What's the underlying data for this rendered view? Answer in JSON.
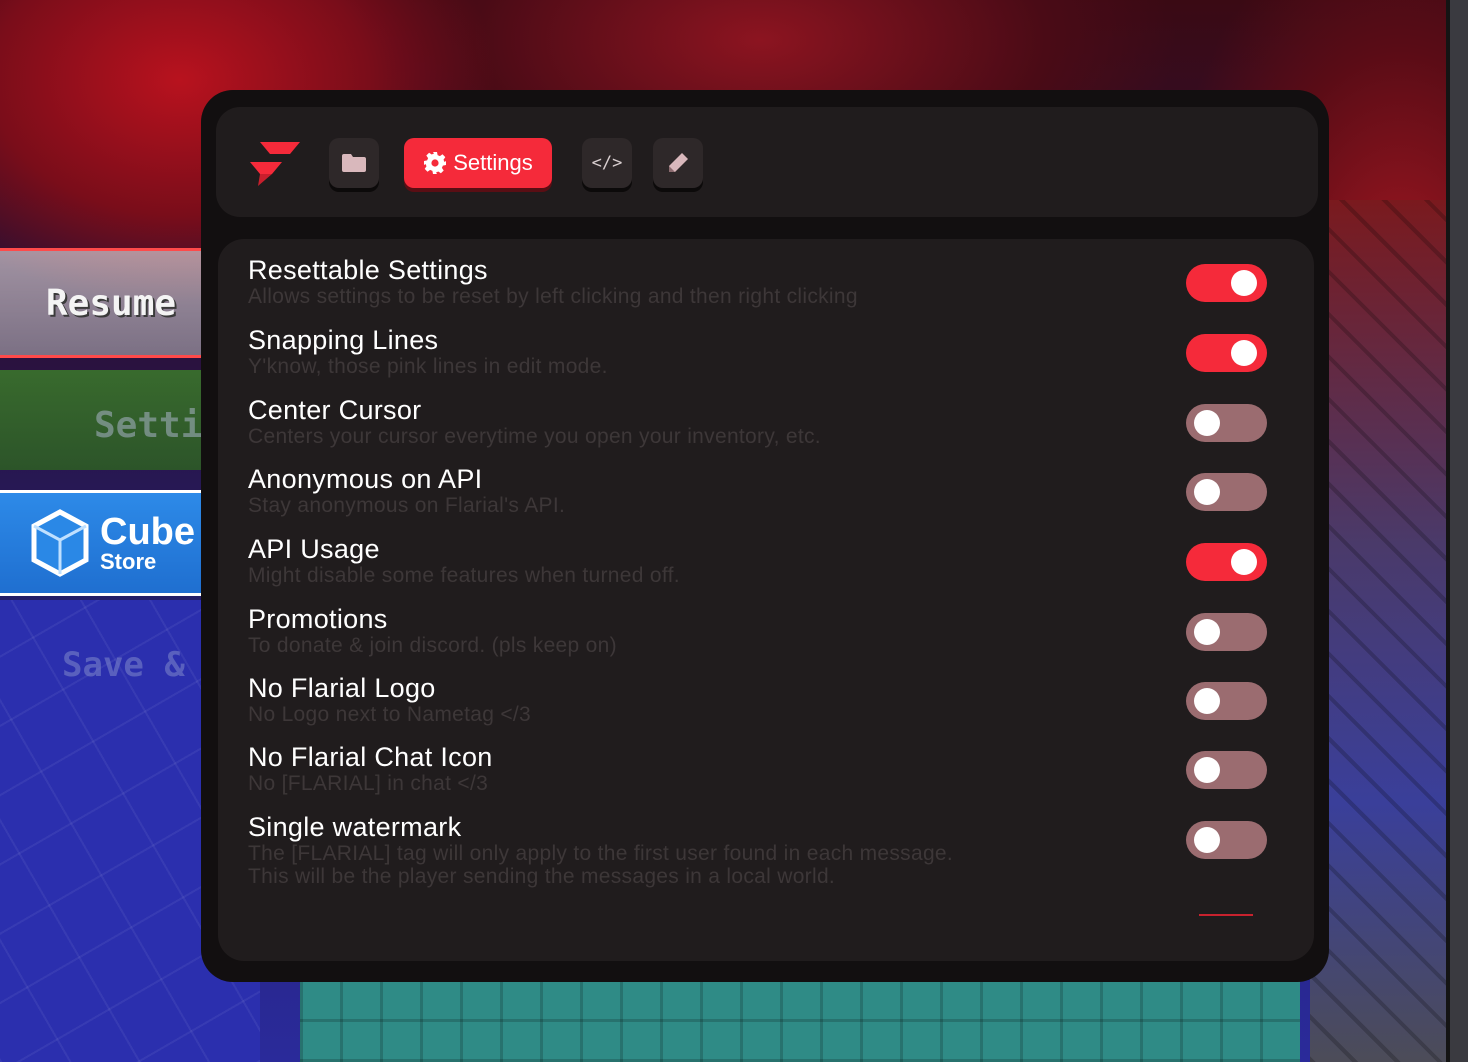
{
  "pause_menu": {
    "resume_label": "Resume",
    "settings_label": "Settin",
    "cube_store": {
      "name": "Cube",
      "sub": "Store"
    },
    "save_label": "Save &"
  },
  "topbar": {
    "logo_icon": "flarial-logo-icon",
    "tabs": [
      {
        "icon": "folder-icon",
        "label": ""
      },
      {
        "icon": "gear-icon",
        "label": "Settings",
        "active": true
      },
      {
        "icon": "code-icon",
        "label": "</>"
      },
      {
        "icon": "pencil-icon",
        "label": ""
      }
    ]
  },
  "colors": {
    "accent": "#f52a3a",
    "toggle_off": "#9b6c70",
    "panel_bg": "#120f10",
    "card_bg": "#201c1d"
  },
  "settings": [
    {
      "title": "Resettable Settings",
      "description": "Allows settings to be reset by left clicking and then right clicking",
      "enabled": true
    },
    {
      "title": "Snapping Lines",
      "description": "Y'know, those pink lines in edit mode.",
      "enabled": true
    },
    {
      "title": "Center Cursor",
      "description": "Centers your cursor everytime you open your inventory, etc.",
      "enabled": false
    },
    {
      "title": "Anonymous on API",
      "description": "Stay anonymous on Flarial's API.",
      "enabled": false
    },
    {
      "title": "API Usage",
      "description": "Might disable some features when turned off.",
      "enabled": true
    },
    {
      "title": "Promotions",
      "description": "To donate & join discord. (pls keep on)",
      "enabled": false
    },
    {
      "title": "No Flarial Logo",
      "description": "No Logo next to Nametag </3",
      "enabled": false
    },
    {
      "title": "No Flarial Chat Icon",
      "description": "No [FLARIAL] in chat </3",
      "enabled": false
    },
    {
      "title": "Single watermark",
      "description": "The [FLARIAL] tag will only apply to the first user found in each message.\nThis will be the player sending the messages in a local world.",
      "enabled": false
    }
  ]
}
